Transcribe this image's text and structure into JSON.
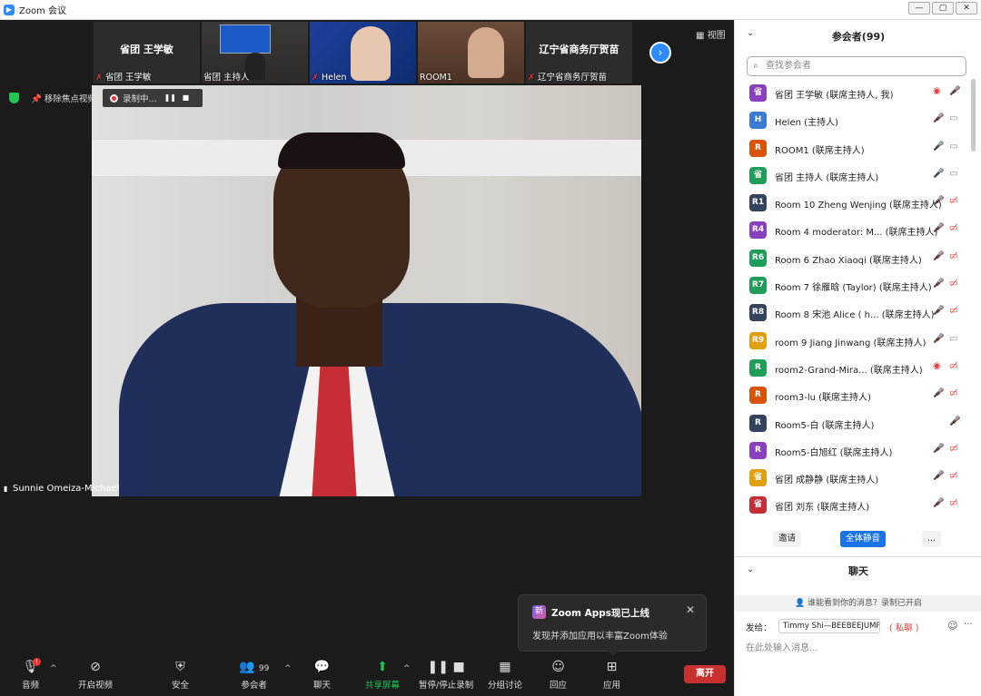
{
  "window": {
    "title": "Zoom 会议",
    "controls": [
      "—",
      "▢",
      "✕"
    ]
  },
  "thumbnails": [
    {
      "big_label": "省团 王学敏",
      "name": "省团 王学敏"
    },
    {
      "big_label": "",
      "name": "省团 主持人"
    },
    {
      "big_label": "",
      "name": "Helen"
    },
    {
      "big_label": "",
      "name": "ROOM1"
    },
    {
      "big_label": "辽宁省商务厅贺苗",
      "name": "辽宁省商务厅贺苗"
    }
  ],
  "top": {
    "view_label": "视图",
    "unpin_label": "移除焦点视频",
    "recording_label": "录制中..."
  },
  "speaker": {
    "name": "Sunnie Omeiza-Michael"
  },
  "toast": {
    "badge": "新",
    "title": "Zoom Apps现已上线",
    "body": "发现并添加应用以丰富Zoom体验",
    "close": "✕"
  },
  "toolbar": {
    "audio": "音频",
    "audio_badge": "!",
    "video": "开启视频",
    "security": "安全",
    "participants": "参会者",
    "participants_count": "99",
    "chat": "聊天",
    "share": "共享屏幕",
    "record": "暂停/停止录制",
    "breakout": "分组讨论",
    "reactions": "回应",
    "apps": "应用",
    "leave": "离开"
  },
  "panel": {
    "title": "参会者(99)",
    "search_placeholder": "查找参会者",
    "participants": [
      {
        "avatar": "省",
        "color": "#8a3fbf",
        "name": "省团 王学敏 (联席主持人, 我)",
        "icon1": "◉",
        "icon1_color": "#e03b3b",
        "icon2": "🎤̸",
        "icon2_color": "#e03b3b"
      },
      {
        "avatar": "H",
        "color": "#3a7bd5",
        "name": "Helen (主持人)",
        "icon1": "🎤̸",
        "icon1_color": "#e03b3b",
        "icon2": "▭",
        "icon2_color": "#888"
      },
      {
        "avatar": "R",
        "color": "#d9540a",
        "name": "ROOM1 (联席主持人)",
        "icon1": "🎤",
        "icon1_color": "#888",
        "icon2": "▭",
        "icon2_color": "#888"
      },
      {
        "avatar": "省",
        "color": "#1f9e5a",
        "name": "省团 主持人 (联席主持人)",
        "icon1": "🎤",
        "icon1_color": "#888",
        "icon2": "▭",
        "icon2_color": "#888"
      },
      {
        "avatar": "R1",
        "color": "#35445e",
        "name": "Room 10 Zheng Wenjing (联席主持人)",
        "icon1": "🎤̸",
        "icon1_color": "#e03b3b",
        "icon2": "▭̸",
        "icon2_color": "#e03b3b"
      },
      {
        "avatar": "R4",
        "color": "#8a3fbf",
        "name": "Room 4 moderator: M...  (联席主持人)",
        "icon1": "🎤̸",
        "icon1_color": "#e03b3b",
        "icon2": "▭̸",
        "icon2_color": "#e03b3b"
      },
      {
        "avatar": "R6",
        "color": "#1f9e5a",
        "name": "Room 6 Zhao Xiaoqi (联席主持人)",
        "icon1": "🎤̸",
        "icon1_color": "#e03b3b",
        "icon2": "▭̸",
        "icon2_color": "#e03b3b"
      },
      {
        "avatar": "R7",
        "color": "#1f9e5a",
        "name": "Room 7 徐雁晗 (Taylor) (联席主持人)",
        "icon1": "🎤̸",
        "icon1_color": "#e03b3b",
        "icon2": "▭̸",
        "icon2_color": "#e03b3b"
      },
      {
        "avatar": "R8",
        "color": "#35445e",
        "name": "Room 8  宋池 Alice ( h...  (联席主持人)",
        "icon1": "🎤̸",
        "icon1_color": "#e03b3b",
        "icon2": "▭̸",
        "icon2_color": "#e03b3b"
      },
      {
        "avatar": "R9",
        "color": "#e0a010",
        "name": "room 9 Jiang Jinwang (联席主持人)",
        "icon1": "🎤̸",
        "icon1_color": "#e03b3b",
        "icon2": "▭",
        "icon2_color": "#888"
      },
      {
        "avatar": "R",
        "color": "#1f9e5a",
        "name": "room2-Grand-Mira...  (联席主持人)",
        "icon1": "◉",
        "icon1_color": "#e03b3b",
        "icon2": "▭̸",
        "icon2_color": "#e03b3b"
      },
      {
        "avatar": "R",
        "color": "#d9540a",
        "name": "room3-lu (联席主持人)",
        "icon1": "🎤̸",
        "icon1_color": "#e03b3b",
        "icon2": "▭̸",
        "icon2_color": "#e03b3b"
      },
      {
        "avatar": "R",
        "color": "#35445e",
        "name": "Room5-白 (联席主持人)",
        "icon1": "",
        "icon1_color": "#888",
        "icon2": "🎤̸",
        "icon2_color": "#e03b3b"
      },
      {
        "avatar": "R",
        "color": "#8a3fbf",
        "name": "Room5-白旭红 (联席主持人)",
        "icon1": "🎤̸",
        "icon1_color": "#e03b3b",
        "icon2": "▭̸",
        "icon2_color": "#e03b3b"
      },
      {
        "avatar": "省",
        "color": "#e0a010",
        "name": "省团 成静静 (联席主持人)",
        "icon1": "🎤̸",
        "icon1_color": "#e03b3b",
        "icon2": "▭̸",
        "icon2_color": "#e03b3b"
      },
      {
        "avatar": "省",
        "color": "#c62d35",
        "name": "省团 刘东 (联席主持人)",
        "icon1": "🎤̸",
        "icon1_color": "#e03b3b",
        "icon2": "▭̸",
        "icon2_color": "#e03b3b"
      }
    ],
    "invite": "邀请",
    "mute_all": "全体静音",
    "more": "...",
    "chat_title": "聊天",
    "chat_notice": "谁能看到你的消息？录制已开启",
    "send_to_label": "发给：",
    "send_to_value": "Timmy Shi—BEEBEEJUMP ⌄",
    "private_label": "( 私聊 )",
    "chat_placeholder": "在此处输入消息..."
  }
}
